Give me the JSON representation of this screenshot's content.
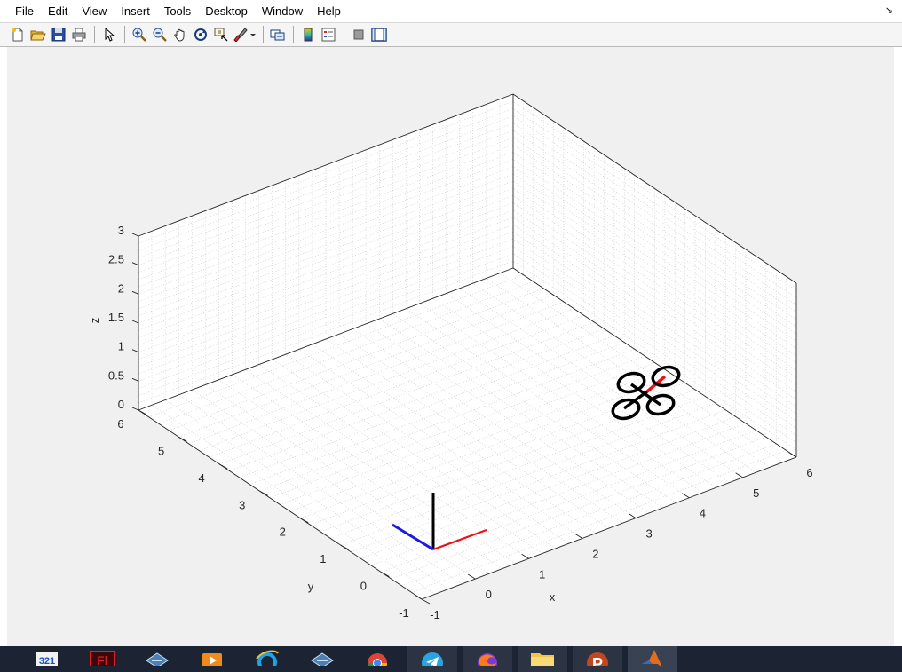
{
  "menu": [
    "File",
    "Edit",
    "View",
    "Insert",
    "Tools",
    "Desktop",
    "Window",
    "Help"
  ],
  "menu_dock_glyph": "↘",
  "toolbar_icons": [
    "new-figure-icon",
    "open-file-icon",
    "save-icon",
    "print-icon",
    "edit-plot-arrow-icon",
    "zoom-in-icon",
    "zoom-out-icon",
    "pan-icon",
    "rotate-3d-icon",
    "data-cursor-icon",
    "brush-icon",
    "link-plot-icon",
    "colorbar-icon",
    "legend-icon",
    "hide-plot-tools-icon",
    "show-plot-tools-icon"
  ],
  "axes": {
    "x_label": "x",
    "y_label": "y",
    "z_label": "z",
    "x_ticks": [
      "-1",
      "0",
      "1",
      "2",
      "3",
      "4",
      "5",
      "6"
    ],
    "y_ticks": [
      "-1",
      "0",
      "1",
      "2",
      "3",
      "4",
      "5",
      "6"
    ],
    "z_ticks": [
      "0",
      "0.5",
      "1",
      "1.5",
      "2",
      "2.5",
      "3"
    ],
    "xlim": [
      -1,
      6
    ],
    "ylim": [
      -1,
      6
    ],
    "zlim": [
      0,
      3
    ],
    "grid": true,
    "box": true
  },
  "world_frame": {
    "x_color": "#e8121b",
    "y_color": "#1a1ae0",
    "z_color": "#000000"
  },
  "quadrotor": {
    "heading_color": "#e8121b",
    "rotor_color": "#000000"
  },
  "taskbar_apps": [
    {
      "name": "media-player-classic-icon",
      "text": "321"
    },
    {
      "name": "flash-icon",
      "text": "Fl"
    },
    {
      "name": "vpn-client-icon",
      "text": ""
    },
    {
      "name": "video-player-icon",
      "text": ""
    },
    {
      "name": "internet-explorer-icon",
      "text": ""
    },
    {
      "name": "vpn-client-2-icon",
      "text": ""
    },
    {
      "name": "chrome-icon",
      "text": ""
    },
    {
      "name": "telegram-icon",
      "text": ""
    },
    {
      "name": "firefox-icon",
      "text": ""
    },
    {
      "name": "file-explorer-icon",
      "text": ""
    },
    {
      "name": "psiphon-icon",
      "text": "P"
    },
    {
      "name": "matlab-icon",
      "text": ""
    }
  ]
}
